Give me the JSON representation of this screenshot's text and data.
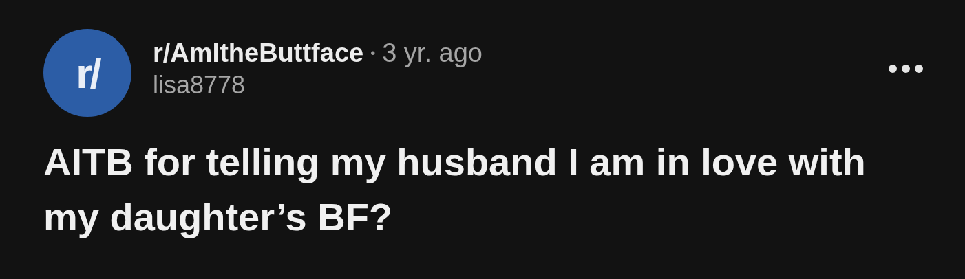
{
  "post": {
    "avatar_text": "r/",
    "subreddit": "r/AmItheButtface",
    "separator": "•",
    "age": "3 yr. ago",
    "author": "lisa8778",
    "title": "AITB for telling my husband I am in love with my daughter’s BF?"
  }
}
